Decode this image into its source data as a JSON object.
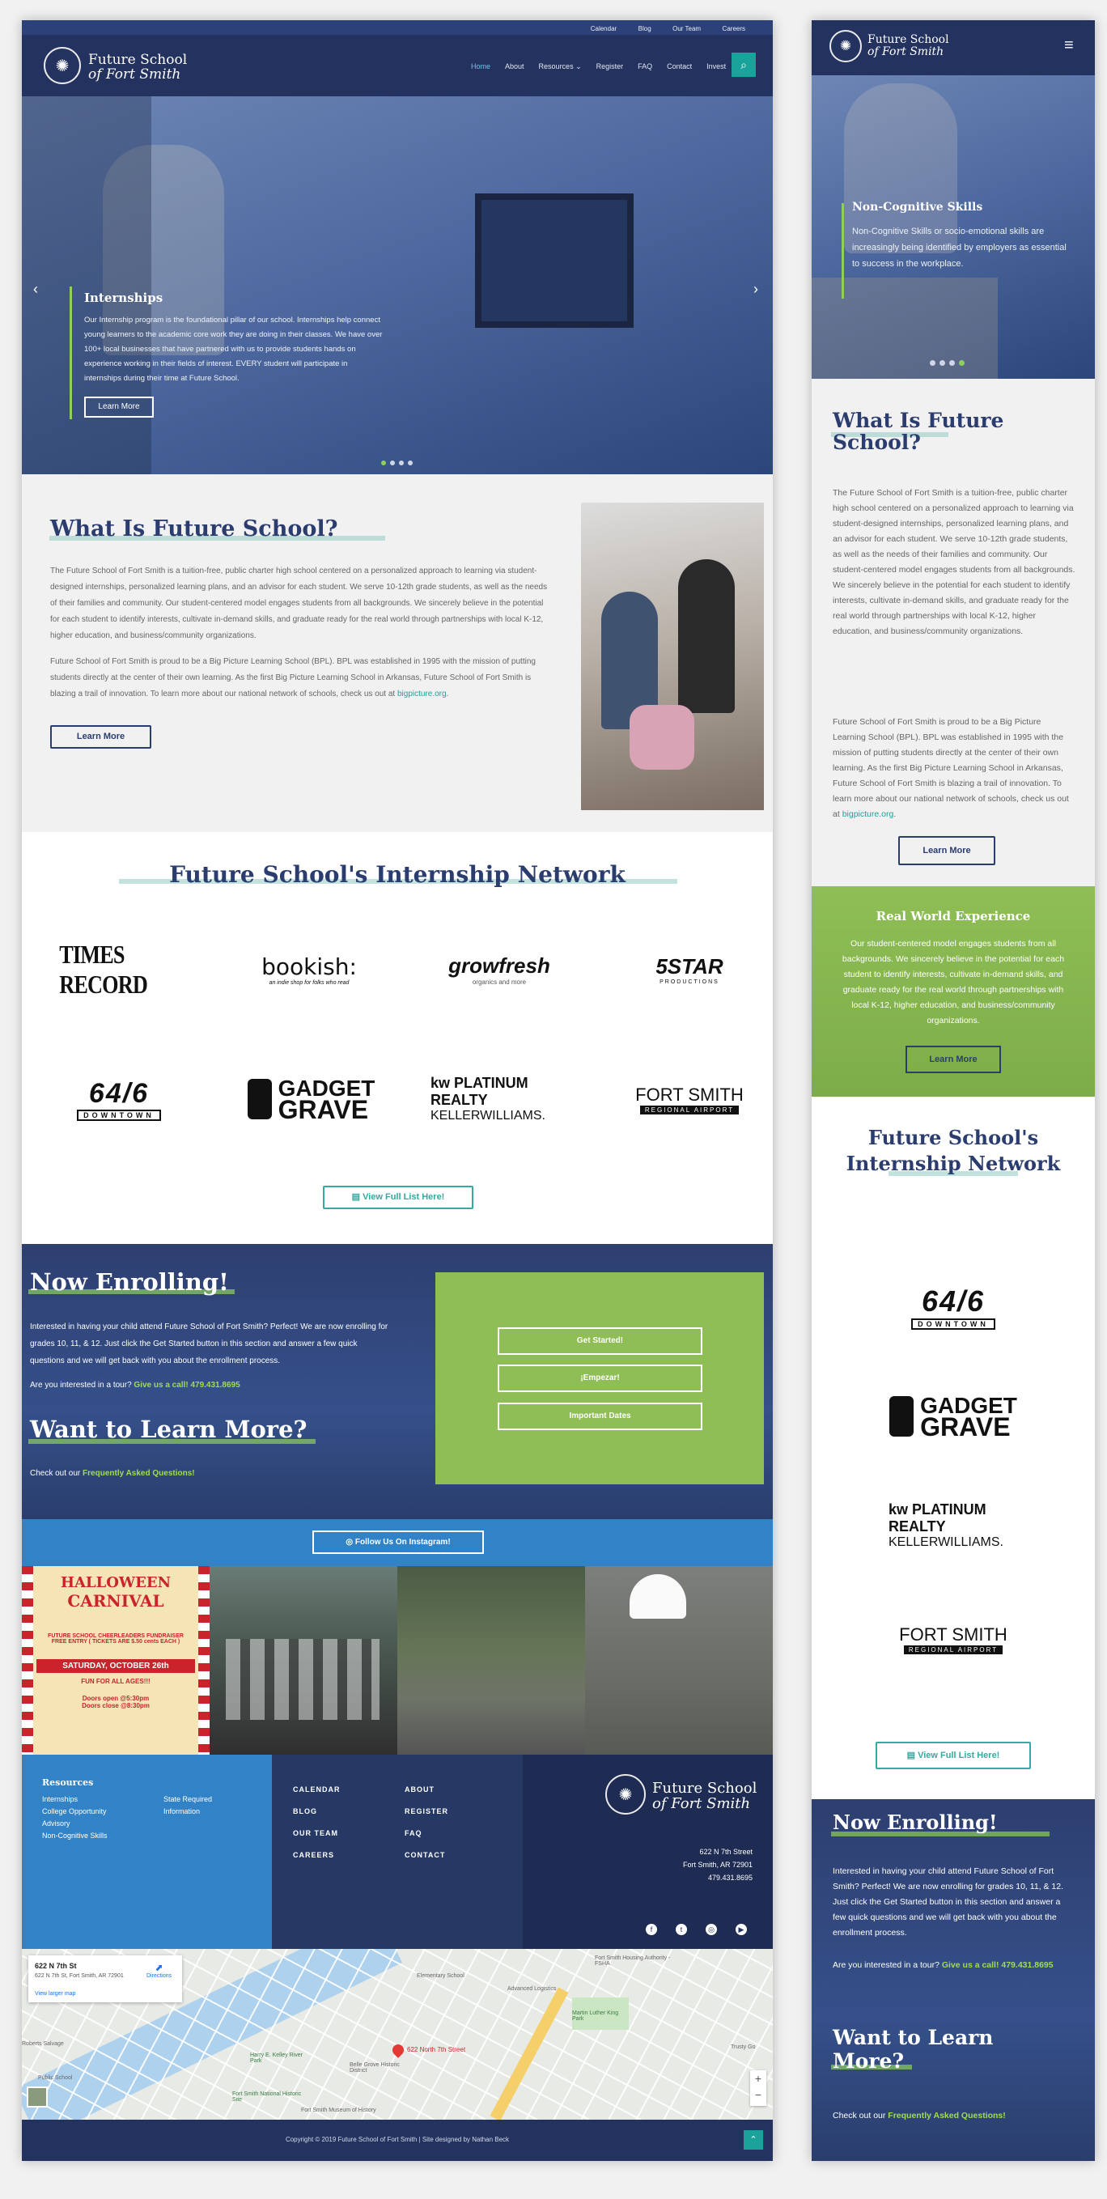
{
  "topbar": {
    "links": [
      "Calendar",
      "Blog",
      "Our Team",
      "Careers"
    ]
  },
  "brand": {
    "line1": "Future School",
    "line2": "of Fort Smith"
  },
  "nav": {
    "items": [
      "Home",
      "About",
      "Resources ⌄",
      "Register",
      "FAQ",
      "Contact",
      "Invest"
    ]
  },
  "hero": {
    "title": "Internships",
    "body": "Our Internship program is the foundational pillar of our school. Internships help connect young learners to the academic core work they are doing in their classes. We have over 100+ local businesses that have partnered with us to provide students hands on experience working in their fields of interest. EVERY student will participate in internships during their time at Future School.",
    "button": "Learn More"
  },
  "about": {
    "title": "What Is Future School?",
    "p1": "The Future School of Fort Smith is a tuition-free, public charter high school centered on a personalized approach to learning via student-designed internships, personalized learning plans, and an advisor for each student. We serve 10-12th grade students, as well as the needs of their families and community. Our student-centered model engages students from all backgrounds. We sincerely believe in the potential for each student to identify interests, cultivate in-demand skills, and graduate ready for the real world through partnerships with local K-12, higher education, and business/community organizations.",
    "p2": "Future School of Fort Smith is proud to be a Big Picture Learning School (BPL). BPL was established in 1995 with the mission of putting students directly at the center of their own learning. As the first Big Picture Learning School in Arkansas, Future School of Fort Smith is blazing a trail of innovation. To learn more about our national network of schools, check us out at ",
    "p2_link": "bigpicture.org",
    "p2_end": ".",
    "button": "Learn More"
  },
  "network": {
    "title": "Future School's Internship Network",
    "logos": [
      {
        "name": "times-record-logo",
        "text": "TIMES RECORD"
      },
      {
        "name": "bookish-logo",
        "text": "bookish:",
        "sub": "an indie shop for folks who read"
      },
      {
        "name": "growfresh-logo",
        "text": "growfresh",
        "sub": "organics and more"
      },
      {
        "name": "5star-logo",
        "text": "5STAR",
        "sub": "PRODUCTIONS"
      },
      {
        "name": "6416-logo",
        "text": "64/6",
        "sub": "DOWNTOWN"
      },
      {
        "name": "gadget-grave-logo",
        "text": "GADGET",
        "sub": "GRAVE"
      },
      {
        "name": "kw-logo",
        "text": "kw PLATINUM REALTY",
        "sub": "KELLERWILLIAMS."
      },
      {
        "name": "fort-smith-airport-logo",
        "text": "FORT SMITH",
        "sub": "REGIONAL AIRPORT"
      }
    ],
    "button": "View Full List Here!"
  },
  "enroll": {
    "title": "Now Enrolling!",
    "body": "Interested in having your child attend Future School of Fort Smith? Perfect! We are now enrolling for grades 10, 11, & 12. Just click the Get Started button in this section and answer a few quick questions and we will get back with you about the enrollment process.",
    "tour": "Are you interested in a tour? ",
    "tour_link": "Give us a call! 479.431.8695",
    "learn_title": "Want to Learn More?",
    "learn_text": "Check out our ",
    "learn_link": "Frequently Asked Questions!",
    "buttons": [
      "Get Started!",
      "¡Empezar!",
      "Important Dates"
    ]
  },
  "instagram": {
    "button": "Follow Us On Instagram!",
    "poster": {
      "t1": "HALLOWEEN",
      "t2": "CARNIVAL",
      "t3": "FUTURE SCHOOL CHEERLEADERS FUNDRAISER",
      "t4": "FREE ENTRY ( TICKETS ARE $.50 cents EACH )",
      "t5": "SATURDAY, OCTOBER 26th",
      "t6": "FUN FOR ALL AGES!!!",
      "t7": "Doors open @5:30pm",
      "t8": "Doors close @8:30pm"
    }
  },
  "footer": {
    "resources_title": "Resources",
    "resources_col1": [
      "Internships",
      "College Opportunity",
      "Advisory",
      "Non-Cognitive Skills"
    ],
    "resources_col2": [
      "State Required Information"
    ],
    "links_col1": [
      "CALENDAR",
      "BLOG",
      "OUR TEAM",
      "CAREERS"
    ],
    "links_col2": [
      "ABOUT",
      "REGISTER",
      "FAQ",
      "CONTACT"
    ],
    "address": [
      "622 N 7th Street",
      "Fort Smith, AR 72901",
      "479.431.8695"
    ],
    "copyright": "Copyright © 2019 Future School of Fort Smith  |  Site designed by Nathan Beck"
  },
  "map": {
    "title": "622 N 7th St",
    "address": "622 N 7th St, Fort Smith, AR 72901",
    "directions": "Directions",
    "larger": "View larger map",
    "pin": "622 North 7th Street",
    "labels": [
      "Fort Smith Housing Authority - FSHA",
      "Elementary School",
      "Advanced Logistics",
      "Martin Luther King Park",
      "Harry E. Kelley River Park",
      "Belle Grove Historic District",
      "Fort Smith National Historic Site",
      "Fort Smith Museum of History",
      "Trusty Go",
      "Roberts Salvage",
      "Public School"
    ]
  },
  "mobile": {
    "hero_title": "Non-Cognitive Skills",
    "hero_body": "Non-Cognitive Skills or socio-emotional skills are increasingly being identified by employers as essential to success in the workplace.",
    "about_title": "What Is Future School?",
    "rw_title": "Real World Experience",
    "rw_body": "Our student-centered model engages students from all backgrounds. We sincerely believe in the potential for each student to identify interests, cultivate in-demand skills, and graduate ready for the real world through partnerships with local K-12, higher education, and business/community organizations.",
    "rw_button": "Learn More"
  }
}
